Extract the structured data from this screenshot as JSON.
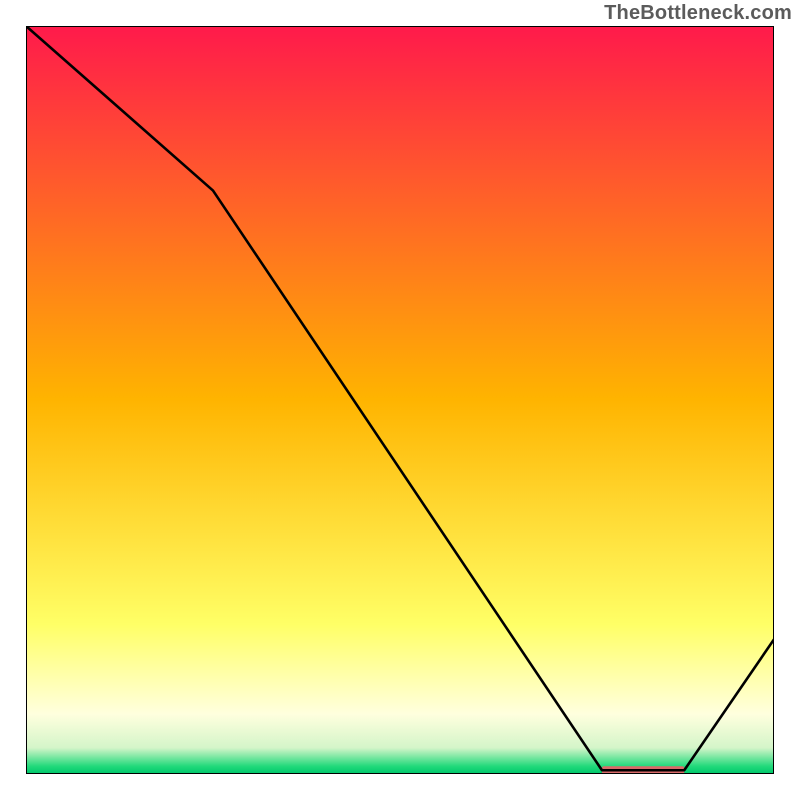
{
  "watermark": "TheBottleneck.com",
  "chart_data": {
    "type": "line",
    "title": "",
    "xlabel": "",
    "ylabel": "",
    "xlim": [
      0,
      100
    ],
    "ylim": [
      0,
      100
    ],
    "grid": false,
    "legend": false,
    "x": [
      0,
      25,
      77,
      88,
      100
    ],
    "values": [
      100,
      78,
      0.5,
      0.5,
      18
    ],
    "optimal_band": {
      "x_start": 77,
      "x_end": 88,
      "y": 0.5
    },
    "background_gradient": [
      {
        "pos": 0.0,
        "color": "#ff1a4b"
      },
      {
        "pos": 0.5,
        "color": "#ffb400"
      },
      {
        "pos": 0.8,
        "color": "#ffff66"
      },
      {
        "pos": 0.92,
        "color": "#ffffde"
      },
      {
        "pos": 0.965,
        "color": "#d4f5c9"
      },
      {
        "pos": 0.99,
        "color": "#1fd97a"
      },
      {
        "pos": 1.0,
        "color": "#00c66a"
      }
    ]
  }
}
